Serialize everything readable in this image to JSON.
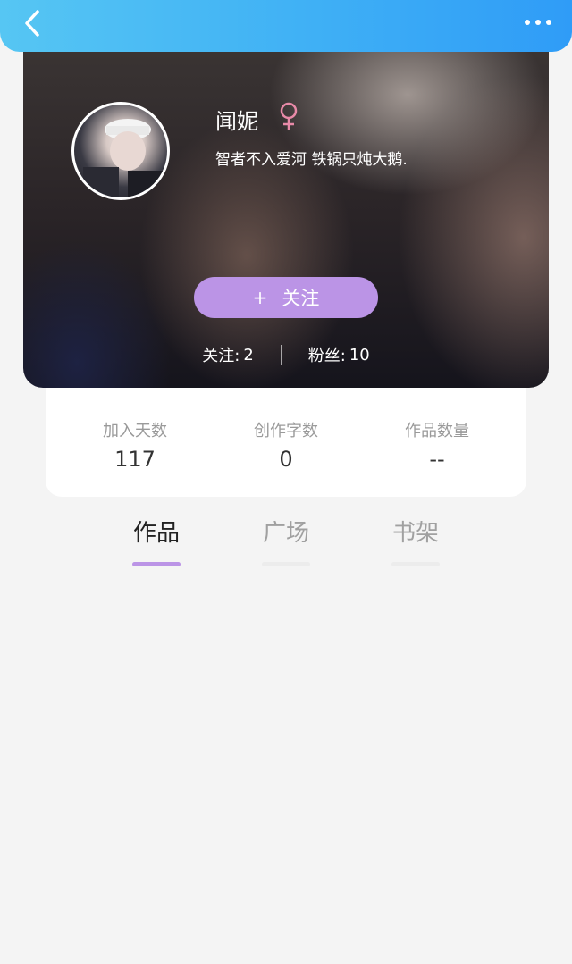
{
  "header": {
    "back_icon": "chevron-left-icon",
    "more_icon": "more-dots-icon",
    "bar_color": "#3fb0f5"
  },
  "profile": {
    "name": "闻妮",
    "gender_icon": "female-symbol-icon",
    "gender_color": "#e88aa8",
    "bio": "智者不入爱河 铁锅只炖大鹅.",
    "follow_button": {
      "plus": "+",
      "label": "关注",
      "color": "#bb94e6"
    },
    "following": {
      "label": "关注:",
      "value": "2"
    },
    "fans": {
      "label": "粉丝:",
      "value": "10"
    }
  },
  "stats": [
    {
      "label": "加入天数",
      "value": "117"
    },
    {
      "label": "创作字数",
      "value": "0"
    },
    {
      "label": "作品数量",
      "value": "--"
    }
  ],
  "tabs": [
    {
      "label": "作品",
      "active": true
    },
    {
      "label": "广场",
      "active": false
    },
    {
      "label": "书架",
      "active": false
    }
  ]
}
